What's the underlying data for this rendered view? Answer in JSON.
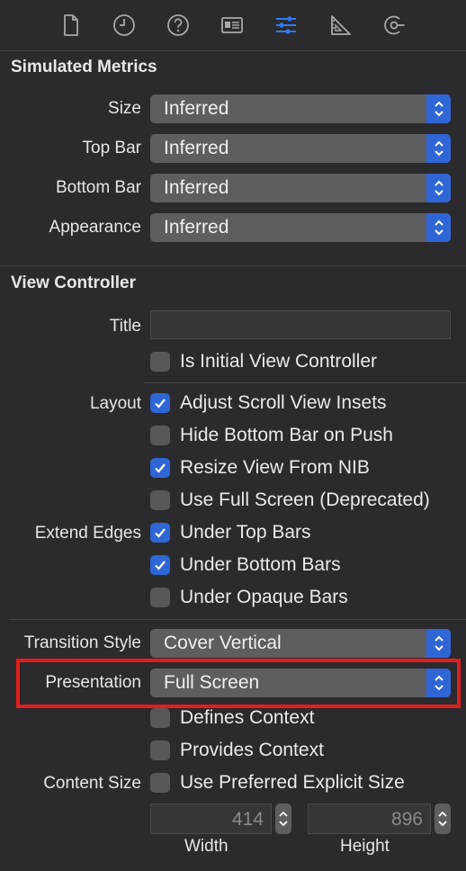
{
  "toolbar": {
    "icons": [
      "file-icon",
      "history-icon",
      "help-icon",
      "identity-icon",
      "attributes-icon",
      "size-ruler-icon",
      "connections-icon"
    ],
    "active_index": 4,
    "active_color": "#2f7bf6"
  },
  "simulated_metrics": {
    "title": "Simulated Metrics",
    "rows": [
      {
        "label": "Size",
        "value": "Inferred"
      },
      {
        "label": "Top Bar",
        "value": "Inferred"
      },
      {
        "label": "Bottom Bar",
        "value": "Inferred"
      },
      {
        "label": "Appearance",
        "value": "Inferred"
      }
    ]
  },
  "view_controller": {
    "title": "View Controller",
    "title_label": "Title",
    "title_value": "",
    "is_initial": {
      "label": "Is Initial View Controller",
      "checked": false
    },
    "layout_label": "Layout",
    "layout_options": [
      {
        "label": "Adjust Scroll View Insets",
        "checked": true
      },
      {
        "label": "Hide Bottom Bar on Push",
        "checked": false
      },
      {
        "label": "Resize View From NIB",
        "checked": true
      },
      {
        "label": "Use Full Screen (Deprecated)",
        "checked": false
      }
    ],
    "extend_edges_label": "Extend Edges",
    "extend_edges_options": [
      {
        "label": "Under Top Bars",
        "checked": true
      },
      {
        "label": "Under Bottom Bars",
        "checked": true
      },
      {
        "label": "Under Opaque Bars",
        "checked": false
      }
    ],
    "transition_style_label": "Transition Style",
    "transition_style_value": "Cover Vertical",
    "presentation_label": "Presentation",
    "presentation_value": "Full Screen",
    "defines_context": {
      "label": "Defines Context",
      "checked": false
    },
    "provides_context": {
      "label": "Provides Context",
      "checked": false
    },
    "content_size_label": "Content Size",
    "preferred_size": {
      "label": "Use Preferred Explicit Size",
      "checked": false
    },
    "width": {
      "value": "414",
      "label": "Width"
    },
    "height": {
      "value": "896",
      "label": "Height"
    }
  },
  "colors": {
    "accent": "#2f66d6",
    "highlight": "#e31d1d",
    "background": "#2b2b2d"
  }
}
